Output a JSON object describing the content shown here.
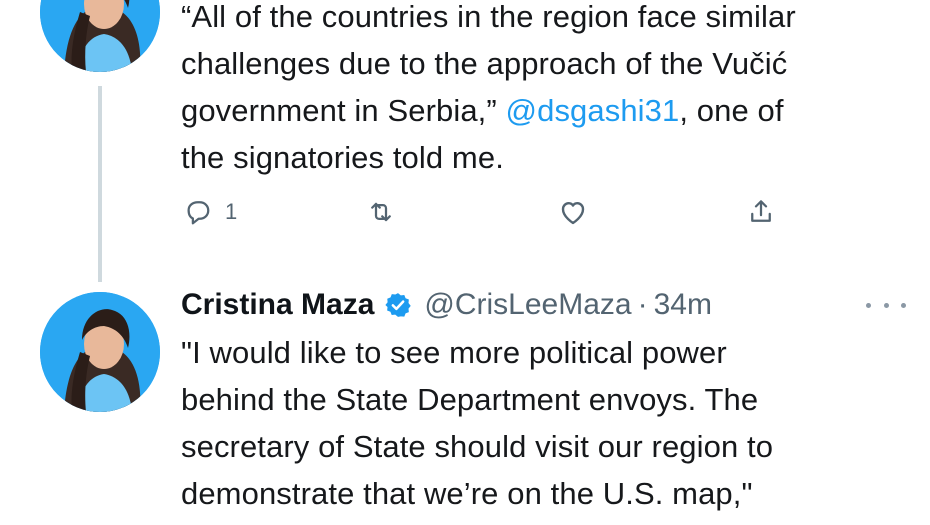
{
  "tweets": [
    {
      "text_lines": [
        "“All of the countries in the region face similar",
        "challenges due to the approach of the Vučić",
        "government in Serbia,”",
        "the signatories told me."
      ],
      "mention": "@dsgashi31",
      "after_mention": ", one of",
      "actions": {
        "reply_icon": "reply-icon",
        "reply_count": "1",
        "retweet_icon": "retweet-icon",
        "like_icon": "heart-icon",
        "share_icon": "share-icon"
      }
    },
    {
      "display_name": "Cristina Maza",
      "verified_icon": "verified-badge-icon",
      "handle": "@CrisLeeMaza",
      "separator": "·",
      "time": "34m",
      "more_icon": "more-icon",
      "text_lines": [
        "\"I would like to see more political power",
        "behind the State Department envoys. The",
        "secretary of State should visit our region to",
        "demonstrate that we’re on the U.S. map,\""
      ]
    }
  ],
  "colors": {
    "text": "#16181b",
    "secondary": "#536471",
    "link": "#1d9bf0",
    "verified": "#1d9bf0",
    "thread_line": "#cfd9de",
    "avatar_bg": "#2aa7f2"
  }
}
